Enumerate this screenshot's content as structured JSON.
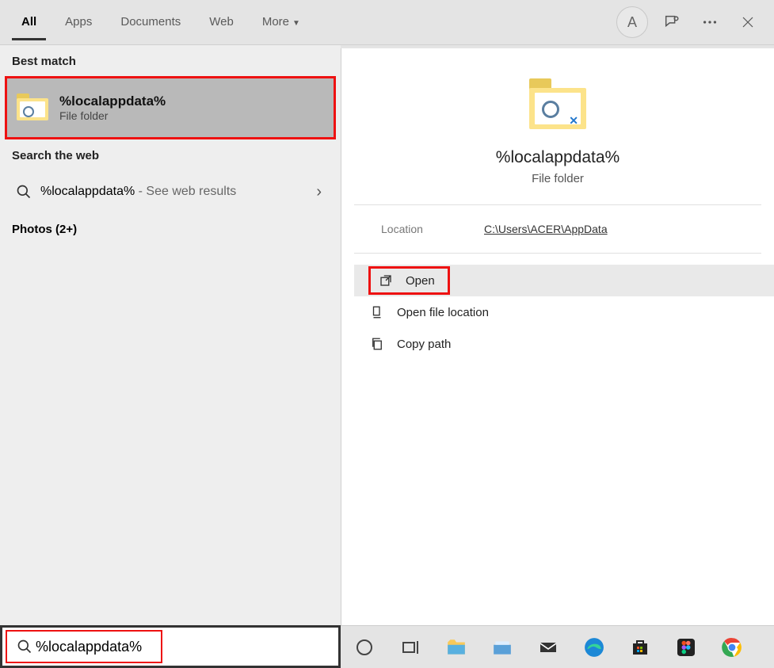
{
  "tabs": {
    "all": "All",
    "apps": "Apps",
    "documents": "Documents",
    "web": "Web",
    "more": "More"
  },
  "avatar": "A",
  "sections": {
    "best_match": "Best match",
    "search_web": "Search the web"
  },
  "best_match": {
    "title": "%localappdata%",
    "subtitle": "File folder"
  },
  "web_result": {
    "query": "%localappdata%",
    "suffix": " - See web results"
  },
  "photos": {
    "label": "Photos (2+)"
  },
  "preview": {
    "title": "%localappdata%",
    "subtitle": "File folder",
    "location_label": "Location",
    "location_value": "C:\\Users\\ACER\\AppData"
  },
  "actions": {
    "open": "Open",
    "open_loc": "Open file location",
    "copy_path": "Copy path"
  },
  "search": {
    "value": "%localappdata%"
  }
}
